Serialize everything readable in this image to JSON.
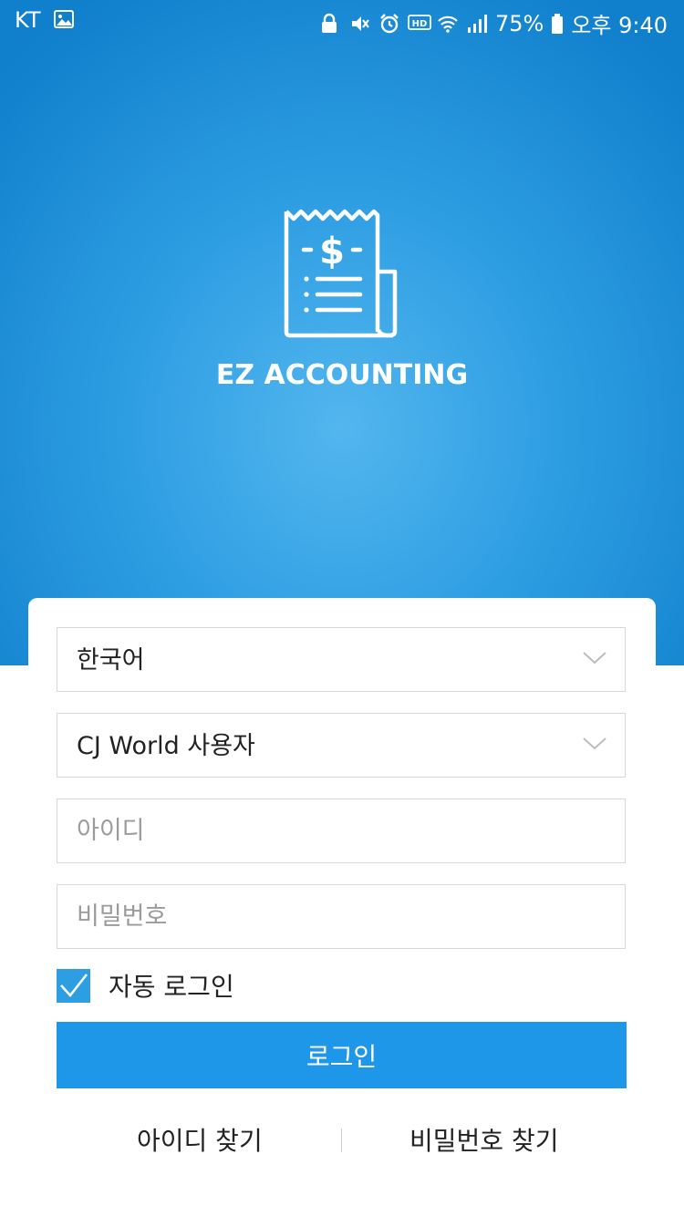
{
  "status_bar": {
    "carrier": "KT",
    "battery_percent": "75%",
    "time": "오후 9:40",
    "left_icons": [
      "image-icon"
    ],
    "right_icons": [
      "lock-icon",
      "mute-icon",
      "alarm-icon",
      "hd-icon",
      "wifi-icon",
      "signal-icon",
      "battery-icon"
    ]
  },
  "header": {
    "logo_icon": "receipt-dollar-icon",
    "app_title": "EZ ACCOUNTING"
  },
  "form": {
    "language_select": {
      "value": "한국어"
    },
    "user_type_select": {
      "value": "CJ World 사용자"
    },
    "id_input": {
      "placeholder": "아이디",
      "value": ""
    },
    "password_input": {
      "placeholder": "비밀번호",
      "value": ""
    },
    "auto_login": {
      "label": "자동 로그인",
      "checked": true
    },
    "login_button": {
      "label": "로그인"
    }
  },
  "links": {
    "find_id": "아이디 찾기",
    "find_password": "비밀번호 찾기"
  },
  "colors": {
    "accent": "#1f97e8",
    "hero_dark": "#107fcc",
    "hero_light": "#53b6ee",
    "border": "#d8d8d8"
  }
}
